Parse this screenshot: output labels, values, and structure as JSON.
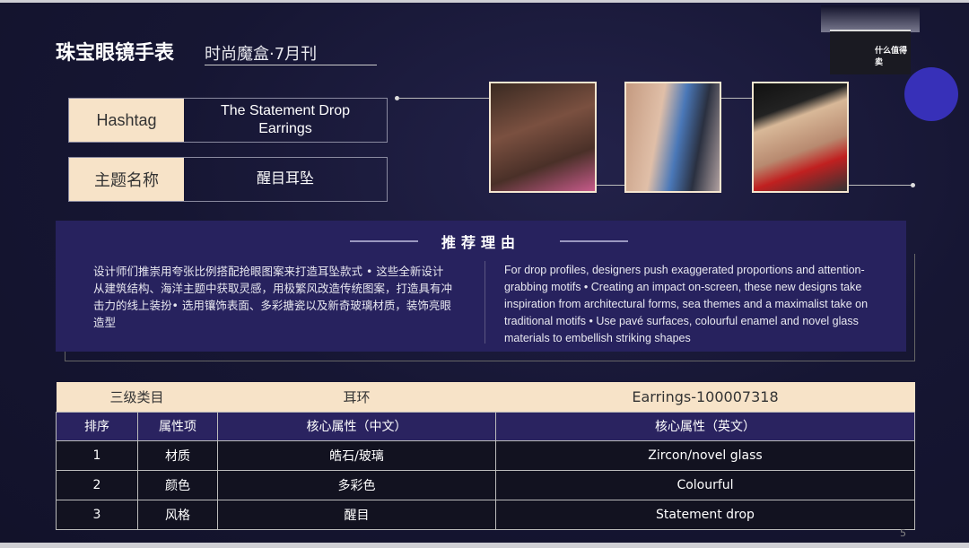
{
  "header": {
    "title": "珠宝眼镜手表",
    "subtitle": "时尚魔盒·7月刊"
  },
  "logo": {
    "brand_text": "什么值得卖"
  },
  "info": [
    {
      "key": "Hashtag",
      "value": "The Statement Drop Earrings"
    },
    {
      "key": "主题名称",
      "value": "醒目耳坠"
    }
  ],
  "reason": {
    "title": "推荐理由",
    "zh": "设计师们推崇用夸张比例搭配抢眼图案来打造耳坠款式 • 这些全新设计从建筑结构、海洋主题中获取灵感，用极繁风改造传统图案，打造具有冲击力的线上装扮• 选用镶饰表面、多彩搪瓷以及新奇玻璃材质，装饰亮眼造型",
    "en": "For drop profiles, designers push exaggerated proportions and attention-grabbing motifs • Creating an impact on-screen, these new designs take inspiration from architectural forms, sea themes and a maximalist take on traditional motifs • Use pavé surfaces, colourful enamel and novel glass materials to embellish striking shapes"
  },
  "table": {
    "category": {
      "label": "三级类目",
      "zh": "耳环",
      "en": "Earrings-100007318"
    },
    "headers": [
      "排序",
      "属性项",
      "核心属性（中文）",
      "核心属性（英文）"
    ],
    "rows": [
      [
        "1",
        "材质",
        "皓石/玻璃",
        "Zircon/novel glass"
      ],
      [
        "2",
        "颜色",
        "多彩色",
        "Colourful"
      ],
      [
        "3",
        "风格",
        "醒目",
        "Statement drop"
      ]
    ]
  },
  "page_number": "5",
  "colors": {
    "background": "#161633",
    "cream": "#f7e3c8",
    "purple": "#27225e",
    "accent_circle": "#3730b8"
  }
}
